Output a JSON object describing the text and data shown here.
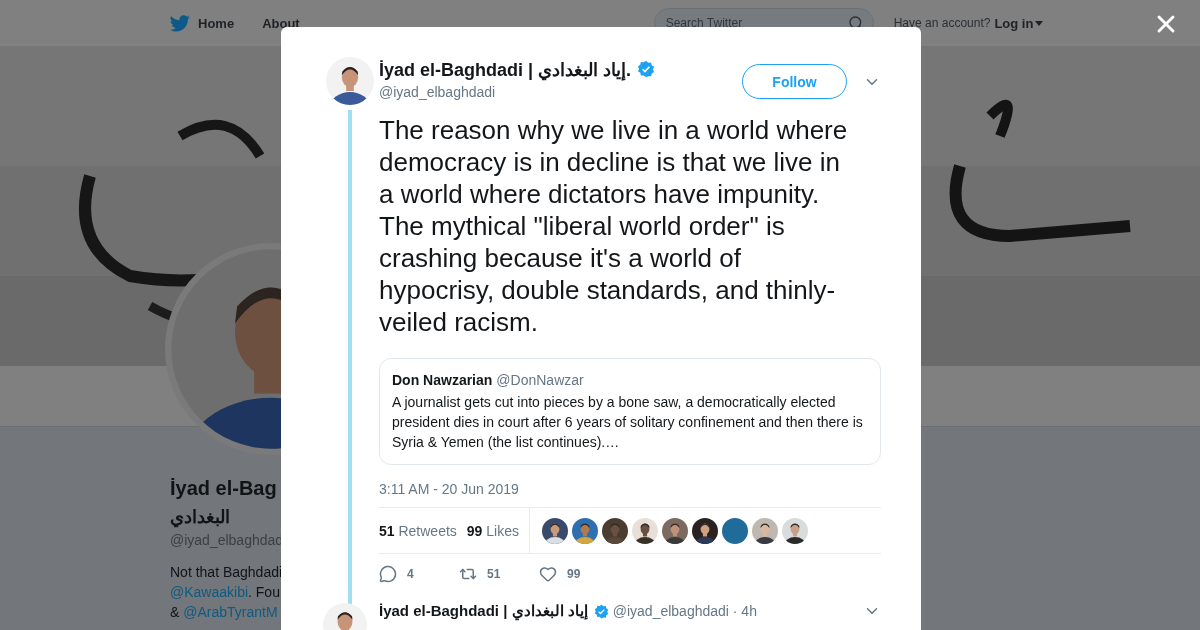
{
  "nav": {
    "items": [
      "Home",
      "About"
    ],
    "search": {
      "placeholder": "Search Twitter"
    },
    "account_prompt": "Have an account?",
    "login": "Log in"
  },
  "profile": {
    "name": "İyad el-Bag",
    "arabic_name": "البغدادي",
    "handle": "@iyad_elbaghdad",
    "bio_lines": [
      [
        {
          "text": "Not that Baghdadi",
          "link": false
        }
      ],
      [
        {
          "text": "@Kawaakibi",
          "link": true
        },
        {
          "text": ". Fou",
          "link": false
        }
      ],
      [
        {
          "text": "& ",
          "link": false
        },
        {
          "text": "@ArabTyrantM",
          "link": true
        }
      ]
    ]
  },
  "tweet": {
    "author": "İyad el-Baghdadi | إياد البغدادي.",
    "verified": true,
    "handle": "@iyad_elbaghdadi",
    "follow": "Follow",
    "text": "The reason why we live in a world where democracy is in decline is that we live in a world where dictators have impunity. The mythical \"liberal world order\" is crashing because it's a world of hypocrisy, double standards, and thinly-veiled racism.",
    "quote": {
      "author": "Don Nawzarian",
      "handle": "@DonNawzar",
      "text": "A journalist gets cut into pieces by a bone saw, a democratically elected president dies in court after 6 years of solitary confinement and then there is Syria & Yemen (the list continues).…"
    },
    "time": "3:11 AM - 20 Jun 2019",
    "stats": [
      {
        "count": "51",
        "label": "Retweets"
      },
      {
        "count": "99",
        "label": "Likes"
      }
    ],
    "likers": [
      {
        "kind": "picture"
      },
      {
        "kind": "picture"
      },
      {
        "kind": "picture"
      },
      {
        "kind": "picture"
      },
      {
        "kind": "picture"
      },
      {
        "kind": "picture"
      },
      {
        "kind": "blank"
      },
      {
        "kind": "picture"
      },
      {
        "kind": "picture"
      }
    ],
    "actions": [
      {
        "kind": "reply",
        "count": "4"
      },
      {
        "kind": "retweet",
        "count": "51"
      },
      {
        "kind": "like",
        "count": "99"
      }
    ]
  },
  "next_tweet": {
    "author": "İyad el-Baghdadi | إياد البغدادي",
    "verified": true,
    "meta": "@iyad_elbaghdadi · 4h"
  }
}
